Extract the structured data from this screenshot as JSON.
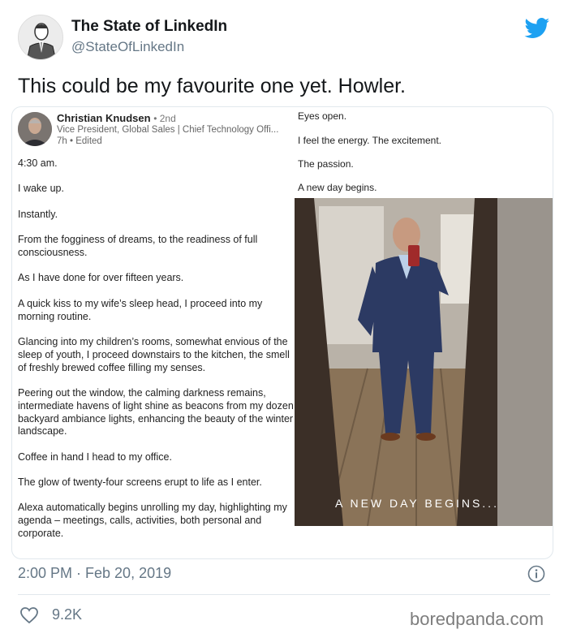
{
  "tweet": {
    "author_name": "The State of LinkedIn",
    "author_handle": "@StateOfLinkedIn",
    "text": "This could be my favourite one yet. Howler.",
    "timestamp": "2:00 PM · Feb 20, 2019",
    "likes": "9.2K",
    "accent_color": "#1da1f2"
  },
  "linkedin_post": {
    "name": "Christian Knudsen",
    "degree": "• 2nd",
    "title": "Vice President, Global Sales | Chief Technology Offi...",
    "time": "7h • Edited",
    "left_paragraphs": [
      "4:30 am.",
      "I wake up.",
      "Instantly.",
      "From the fogginess of dreams, to the readiness of full consciousness.",
      "As I have done for over fifteen years.",
      "A quick kiss to my wife’s sleep head, I proceed into my morning routine.",
      "Glancing into my children’s rooms, somewhat envious of the sleep of youth, I proceed downstairs to the kitchen, the smell of freshly brewed coffee filling my senses.",
      "Peering out the window, the calming darkness remains, intermediate havens of light shine as beacons from my dozen backyard ambiance lights, enhancing the beauty of the winter landscape.",
      "Coffee in hand I head to my office.",
      "The glow of twenty-four screens erupt to life as I enter.",
      "Alexa automatically begins unrolling my day, highlighting my agenda – meetings, calls, activities, both personal and corporate."
    ],
    "right_paragraphs": [
      "Eyes open.",
      "I feel the energy. The excitement.",
      "The passion.",
      "A new day begins."
    ],
    "photo_caption": "A NEW DAY BEGINS..."
  },
  "watermark": "boredpanda.com"
}
